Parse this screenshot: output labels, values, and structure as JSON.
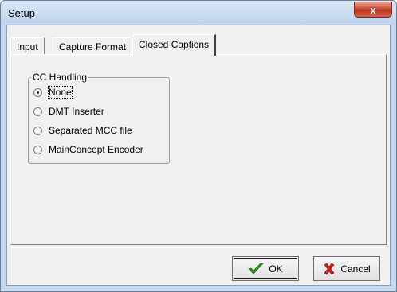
{
  "window": {
    "title": "Setup",
    "close_label": "x"
  },
  "tabs": [
    {
      "label": "Input",
      "active": false
    },
    {
      "label": "Capture Format",
      "active": false
    },
    {
      "label": "Closed Captions",
      "active": true
    }
  ],
  "cc_handling": {
    "title": "CC Handling",
    "options": [
      {
        "label": "None",
        "checked": true
      },
      {
        "label": "DMT Inserter",
        "checked": false
      },
      {
        "label": "Separated MCC file",
        "checked": false
      },
      {
        "label": "MainConcept Encoder",
        "checked": false
      }
    ]
  },
  "buttons": {
    "ok_label": "OK",
    "cancel_label": "Cancel",
    "ok_icon": "checkmark-icon",
    "cancel_icon": "red-x-icon"
  },
  "colors": {
    "ok_icon": "#2e9a1a",
    "cancel_icon": "#c8201a"
  }
}
